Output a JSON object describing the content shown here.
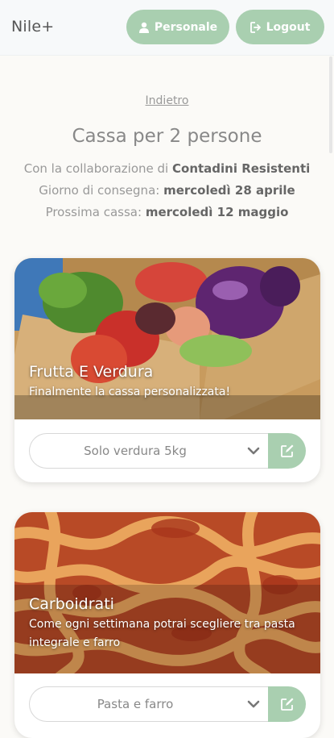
{
  "nav": {
    "brand": "Nile+",
    "personale_label": "Personale",
    "logout_label": "Logout"
  },
  "header": {
    "back_label": "Indietro",
    "title": "Cassa per 2 persone",
    "collab_prefix": "Con la collaborazione di",
    "collab_name": "Contadini Resistenti",
    "delivery_prefix": "Giorno di consegna:",
    "delivery_date": "mercoledì 28 aprile",
    "next_prefix": "Prossima cassa:",
    "next_date": "mercoledì 12 maggio"
  },
  "cards": [
    {
      "title": "Frutta E Verdura",
      "subtitle": "Finalmente la cassa personalizzata!",
      "selected": "Solo verdura 5kg"
    },
    {
      "title": "Carboidrati",
      "subtitle": "Come ogni settimana potrai scegliere tra pasta integrale e farro",
      "selected": "Pasta e farro"
    }
  ],
  "colors": {
    "accent": "#a9cfb0",
    "background": "#fbfaf7"
  },
  "icons": {
    "personale": "user-icon",
    "logout": "sign-out-icon",
    "select": "chevron-down-icon",
    "edit": "edit-icon"
  }
}
